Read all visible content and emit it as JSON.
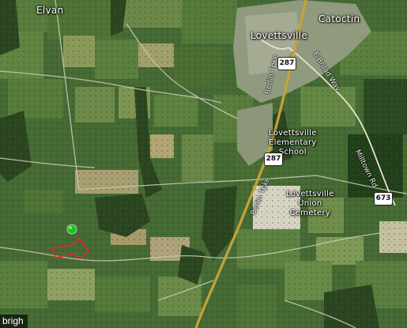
{
  "places": {
    "elvan": "Elvan",
    "lovettsville": "Lovettsville",
    "catoctin": "Catoctin",
    "school": "Lovettsville\nElementary\nSchool",
    "cemetery": "Lovettsville\nUnion\nCemetery"
  },
  "roads": {
    "berlin_tpke_upper": "Berlin Tpke",
    "berlin_tpke_lower": "Berlin Tpke",
    "e_broad_way": "E Broad Way",
    "milltown_rd": "Milltown Rd"
  },
  "shields": {
    "route_287_upper": "287",
    "route_287_lower": "287",
    "route_673": "673"
  },
  "marker": {
    "icon": "location-pin-dot",
    "color": "#22c322"
  },
  "parcel": {
    "outline_color": "#e8262a"
  },
  "watermark": "brigh"
}
